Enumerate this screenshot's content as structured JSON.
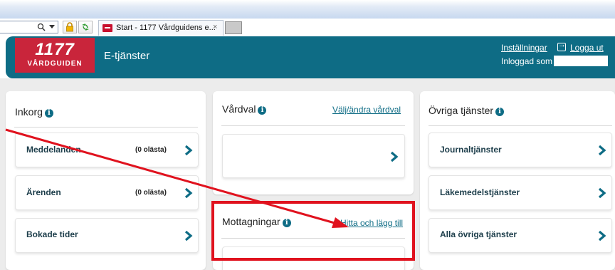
{
  "browser": {
    "tab_title": "Start - 1177 Vårdguidens e...",
    "tab_close": "×",
    "colors": {
      "chrome_top": "#c7d8ef"
    }
  },
  "header": {
    "logo_number": "1177",
    "logo_brand": "VÅRDGUIDEN",
    "title": "E-tjänster",
    "settings_link": "Inställningar",
    "logout_link": "Logga ut",
    "logged_in_label": "Inloggad som",
    "colors": {
      "bar": "#0e6c85",
      "logo": "#c9253b"
    }
  },
  "inbox": {
    "title": "Inkorg",
    "items": [
      {
        "label": "Meddelanden",
        "unread": "(0 olästa)"
      },
      {
        "label": "Ärenden",
        "unread": "(0 olästa)"
      },
      {
        "label": "Bokade tider",
        "unread": ""
      }
    ]
  },
  "care_choice": {
    "title": "Vårdval",
    "link": "Välj/ändra vårdval"
  },
  "clinics": {
    "title": "Mottagningar",
    "link": "Hitta och lägg till"
  },
  "other_services": {
    "title": "Övriga tjänster",
    "items": [
      {
        "label": "Journaltjänster"
      },
      {
        "label": "Läkemedelstjänster"
      },
      {
        "label": "Alla övriga tjänster"
      }
    ]
  },
  "info_glyph": "i",
  "annotation": {
    "color": "#e0121e"
  }
}
